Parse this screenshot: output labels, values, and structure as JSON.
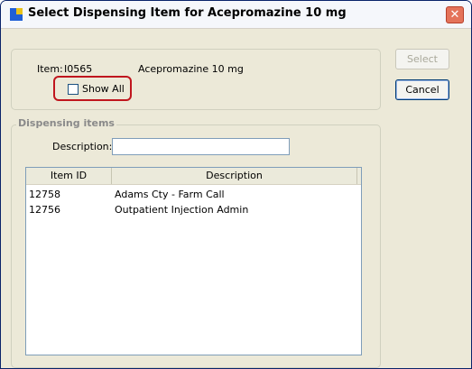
{
  "window": {
    "title": "Select Dispensing Item for Acepromazine 10 mg",
    "close_glyph": "✕"
  },
  "item": {
    "label": "Item:",
    "id": "I0565",
    "name": "Acepromazine 10 mg"
  },
  "show_all": {
    "label": "Show All",
    "checked": false
  },
  "buttons": {
    "select": "Select",
    "cancel": "Cancel"
  },
  "dispensing": {
    "legend": "Dispensing items",
    "description_label": "Description:",
    "description_value": ""
  },
  "list": {
    "columns": [
      "Item ID",
      "Description"
    ],
    "rows": [
      {
        "id": "12758",
        "description": "Adams Cty - Farm Call"
      },
      {
        "id": "12756",
        "description": "Outpatient Injection Admin"
      }
    ]
  },
  "colors": {
    "highlight": "#c0161e",
    "close_button": "#e4735a"
  }
}
